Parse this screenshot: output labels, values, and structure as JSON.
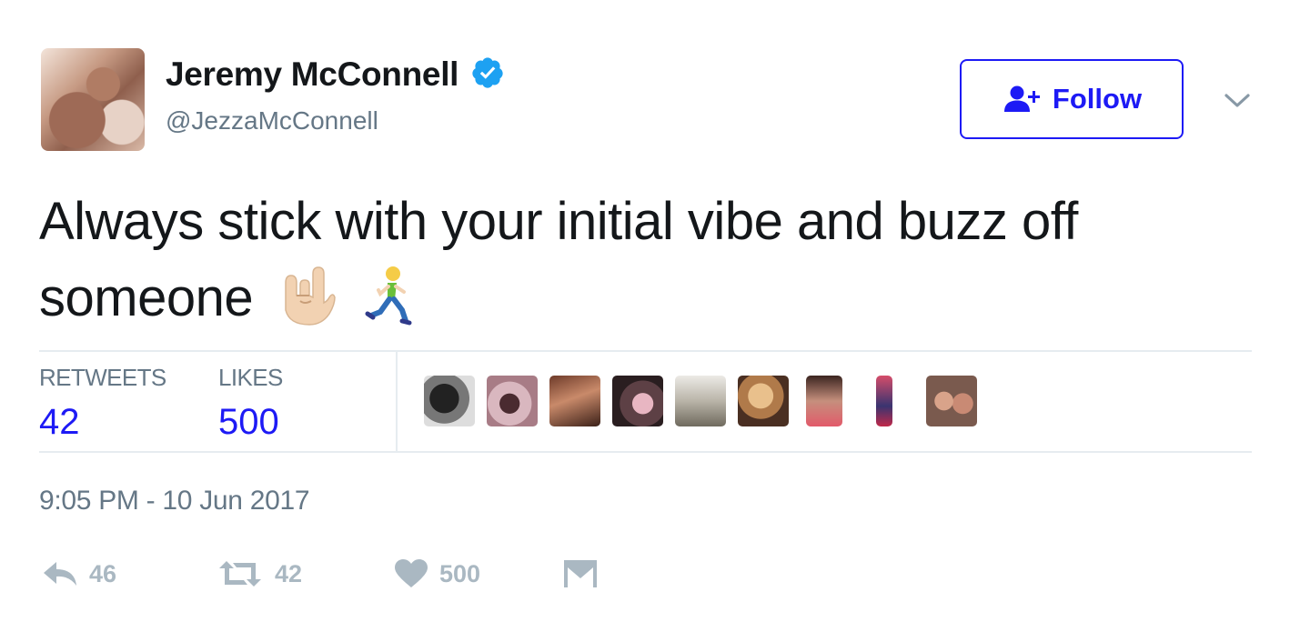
{
  "user": {
    "display_name": "Jeremy McConnell",
    "handle": "@JezzaMcConnell",
    "verified": true,
    "avatar_icon": "profile-photo"
  },
  "follow_button": {
    "label": "Follow",
    "icon": "add-user-icon"
  },
  "menu": {
    "icon": "chevron-down-icon"
  },
  "tweet": {
    "text": "Always stick with your initial vibe and buzz off someone",
    "emojis": [
      "sign-of-the-horns-light-skin-tone",
      "person-running"
    ]
  },
  "stats": {
    "retweets_label": "RETWEETS",
    "retweets_value": "42",
    "likes_label": "LIKES",
    "likes_value": "500"
  },
  "likers_count_shown": 9,
  "timestamp": "9:05 PM - 10 Jun 2017",
  "actions": {
    "reply_count": "46",
    "retweet_count": "42",
    "like_count": "500",
    "dm_icon": "envelope-icon"
  },
  "colors": {
    "accent": "#1d1af5",
    "verified": "#1da1f2",
    "muted": "#657786",
    "icon_gray": "#aab8c2",
    "divider": "#e6ecf0"
  }
}
